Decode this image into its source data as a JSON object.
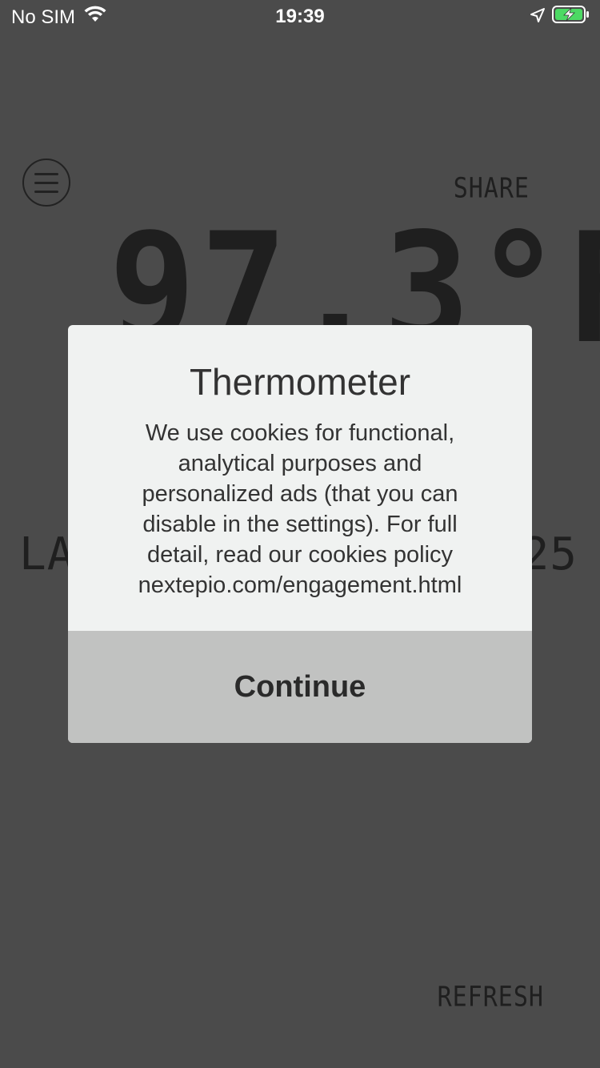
{
  "status_bar": {
    "carrier": "No SIM",
    "time": "19:39",
    "wifi_icon": "wifi-icon",
    "location_icon": "location-arrow-icon",
    "battery_icon": "battery-charging-icon",
    "battery_color": "#4cd964"
  },
  "app": {
    "share_label": "SHARE",
    "temperature_partial": "97.3°F",
    "last_label_partial": "LA",
    "last_value_partial": "25",
    "refresh_label": "REFRESH",
    "menu_icon": "hamburger-menu-icon"
  },
  "dialog": {
    "title": "Thermometer",
    "body_lines": [
      "We use cookies for functional,",
      "analytical purposes and",
      "personalized ads (that you can",
      "disable in the settings). For full",
      "detail, read our cookies policy",
      "nextepio.com/engagement.html"
    ],
    "button_label": "Continue"
  },
  "colors": {
    "background": "#4b4b4b",
    "dialog_background": "#f0f2f1",
    "button_background": "#c1c2c1",
    "lcd_text": "#1f1f1f"
  }
}
